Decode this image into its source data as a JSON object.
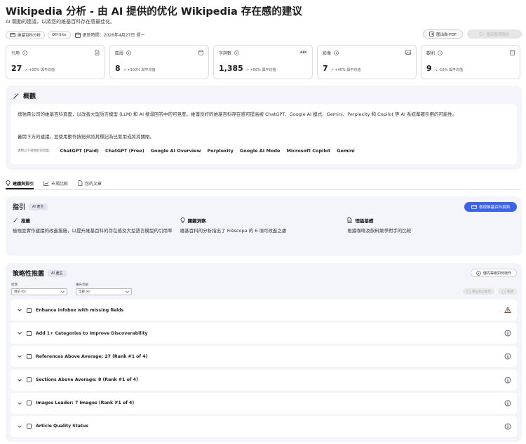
{
  "header": {
    "title": "Wikipedia 分析 - 由 AI 提供的优化 Wikipedia 存在感的建议",
    "subtitle": "AI 驅動的建議，以將您的維基百科存在感最佳化。",
    "chip_wiki": "維基百科分析",
    "chip_offsite": "Off-Site",
    "updated": "更新時間：2026年4月27日 週一",
    "export_pdf": "匯出為 PDF",
    "disabled_action": "重新整理報告"
  },
  "metrics": [
    {
      "label": "引用",
      "value": "27",
      "trend": "↗ +50% 與平均值",
      "icon": "document-icon"
    },
    {
      "label": "區段",
      "value": "8",
      "trend": "↗ +100% 與平均值",
      "icon": "database-icon"
    },
    {
      "label": "字詞數",
      "value": "1,385",
      "trend": "↗ +66% 與平均值",
      "icon": "abc-icon"
    },
    {
      "label": "影像",
      "value": "7",
      "trend": "↗ +40% 與平均值",
      "icon": "image-icon"
    },
    {
      "label": "觀則",
      "value": "9",
      "trend": "↘ -10% 與平均值",
      "icon": "page-icon"
    }
  ],
  "overview": {
    "heading": "概觀",
    "text1": "增強貴公司的維基百科頁面，以改善大型語言模型 (LLM) 和 AI 搜尋回答中的可見度。維護良好的維基百科存在感可提高被 ChatGPT、Google AI 模式、Gemini、Perplexity 和 Copilot 等 AI 系統準確引用的可能性。",
    "text2": "審閱下方的建議，並使用動作按鈕來將其標記為已套用或將其關閉。",
    "llm_caption": "適用以下項目的可見度：",
    "llms": [
      "ChatGPT (Paid)",
      "ChatGPT (Free)",
      "Google AI Overview",
      "Perplexity",
      "Google AI Mode",
      "Microsoft Copilot",
      "Gemini"
    ]
  },
  "tabs": [
    {
      "label": "建議與指引",
      "active": true
    },
    {
      "label": "市場比較",
      "active": false
    },
    {
      "label": "您的文章",
      "active": false
    }
  ],
  "guidance": {
    "heading": "指引",
    "ai_badge": "AI 產生",
    "open_button": "檢視維基百科頁面",
    "cols": [
      {
        "title": "推薦",
        "text": "檢視並實作建議的改進措施，以提升維基百科的存在感及大型語言模型的引用率"
      },
      {
        "title": "關鍵洞察",
        "text": "維基百科的分析指出了 Frèscopa 的 6 項可改進之處"
      },
      {
        "title": "理論基礎",
        "text": "根據咖啡及飲料競爭對手的比較"
      }
    ]
  },
  "strategy": {
    "heading": "策略性推薦",
    "ai_badge": "AI 產生",
    "info_button": "優先等級如何運作",
    "filter_status_label": "狀態",
    "filter_status_value": "目前 (6)",
    "filter_priority_label": "優先等級",
    "filter_priority_value": "全部 (6)",
    "mark_applied": "標記為已套用",
    "dismiss": "關閉",
    "recommendations": [
      {
        "label": "Enhance infobox with missing fields",
        "status": "warning"
      },
      {
        "label": "Add 1+ Categories to Improve Discoverability",
        "status": "info"
      },
      {
        "label": "References Above Average: 27 (Rank #1 of 4)",
        "status": "info"
      },
      {
        "label": "Sections Above Average: 8 (Rank #1 of 4)",
        "status": "info"
      },
      {
        "label": "Images Leader: 7 Images (Rank #1 of 4)",
        "status": "info"
      },
      {
        "label": "Article Quality Status",
        "status": "info"
      }
    ]
  }
}
